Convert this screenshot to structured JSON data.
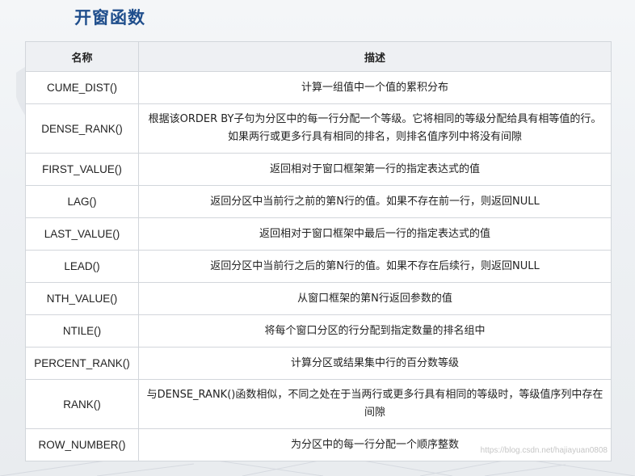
{
  "title": "开窗函数",
  "headers": {
    "name": "名称",
    "description": "描述"
  },
  "rows": [
    {
      "name": "CUME_DIST()",
      "description": "计算一组值中一个值的累积分布"
    },
    {
      "name": "DENSE_RANK()",
      "description": "根据该ORDER BY子句为分区中的每一行分配一个等级。它将相同的等级分配给具有相等值的行。如果两行或更多行具有相同的排名，则排名值序列中将没有间隙"
    },
    {
      "name": "FIRST_VALUE()",
      "description": "返回相对于窗口框架第一行的指定表达式的值"
    },
    {
      "name": "LAG()",
      "description": "返回分区中当前行之前的第N行的值。如果不存在前一行，则返回NULL"
    },
    {
      "name": "LAST_VALUE()",
      "description": "返回相对于窗口框架中最后一行的指定表达式的值"
    },
    {
      "name": "LEAD()",
      "description": "返回分区中当前行之后的第N行的值。如果不存在后续行，则返回NULL"
    },
    {
      "name": "NTH_VALUE()",
      "description": "从窗口框架的第N行返回参数的值"
    },
    {
      "name": "NTILE()",
      "description": "将每个窗口分区的行分配到指定数量的排名组中"
    },
    {
      "name": "PERCENT_RANK()",
      "description": "计算分区或结果集中行的百分数等级"
    },
    {
      "name": "RANK()",
      "description": "与DENSE_RANK()函数相似，不同之处在于当两行或更多行具有相同的等级时，等级值序列中存在间隙"
    },
    {
      "name": "ROW_NUMBER()",
      "description": "为分区中的每一行分配一个顺序整数"
    }
  ],
  "watermark": "https://blog.csdn.net/hajiayuan0808"
}
